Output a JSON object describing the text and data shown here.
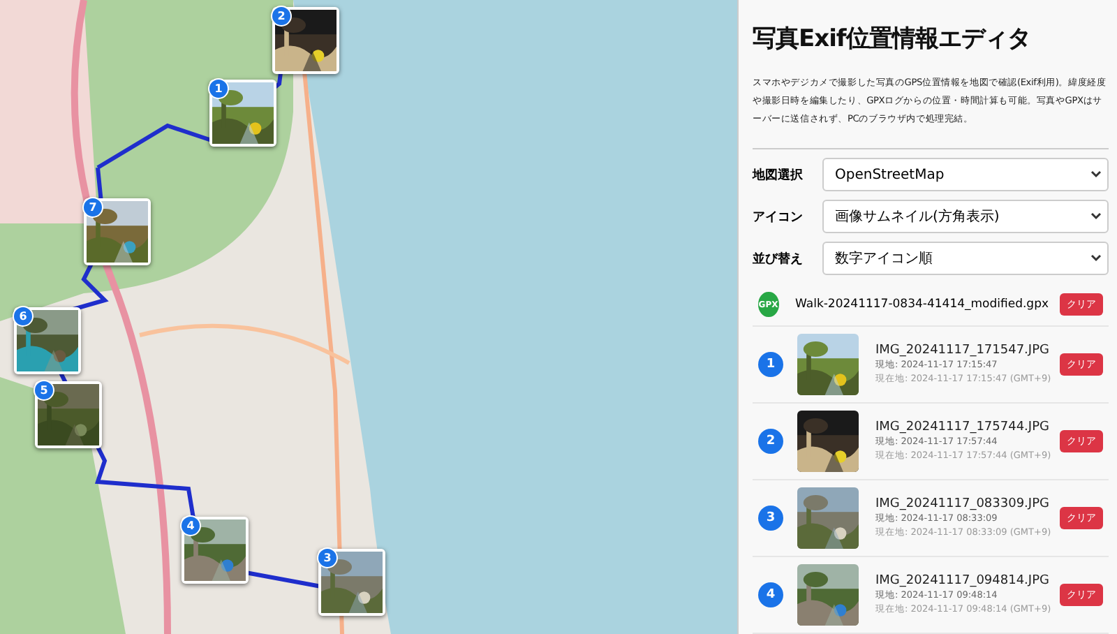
{
  "map": {
    "markers": [
      {
        "number": "1"
      },
      {
        "number": "2"
      },
      {
        "number": "3"
      },
      {
        "number": "4"
      },
      {
        "number": "5"
      },
      {
        "number": "6"
      },
      {
        "number": "7"
      }
    ]
  },
  "panel": {
    "title": "写真Exif位置情報エディタ",
    "description": "スマホやデジカメで撮影した写真のGPS位置情報を地図で確認(Exif利用)。緯度経度や撮影日時を編集したり、GPXログからの位置・時間計算も可能。写真やGPXはサーバーに送信されず、PCのブラウザ内で処理完結。",
    "settings": [
      {
        "label": "地図選択",
        "value": "OpenStreetMap"
      },
      {
        "label": "アイコン",
        "value": "画像サムネイル(方角表示)"
      },
      {
        "label": "並び替え",
        "value": "数字アイコン順"
      }
    ],
    "gpx": {
      "badge": "GPX",
      "file": "Walk-20241117-0834-41414_modified.gpx",
      "button": "クリア"
    },
    "photos": [
      {
        "number": "1",
        "file": "IMG_20241117_171547.JPG",
        "taken": "現地: 2024-11-17 17:15:47",
        "local": "現在地: 2024-11-17 17:15:47 (GMT+9)",
        "button": "クリア"
      },
      {
        "number": "2",
        "file": "IMG_20241117_175744.JPG",
        "taken": "現地: 2024-11-17 17:57:44",
        "local": "現在地: 2024-11-17 17:57:44 (GMT+9)",
        "button": "クリア"
      },
      {
        "number": "3",
        "file": "IMG_20241117_083309.JPG",
        "taken": "現地: 2024-11-17 08:33:09",
        "local": "現在地: 2024-11-17 08:33:09 (GMT+9)",
        "button": "クリア"
      },
      {
        "number": "4",
        "file": "IMG_20241117_094814.JPG",
        "taken": "現地: 2024-11-17 09:48:14",
        "local": "現在地: 2024-11-17 09:48:14 (GMT+9)",
        "button": "クリア"
      }
    ]
  }
}
